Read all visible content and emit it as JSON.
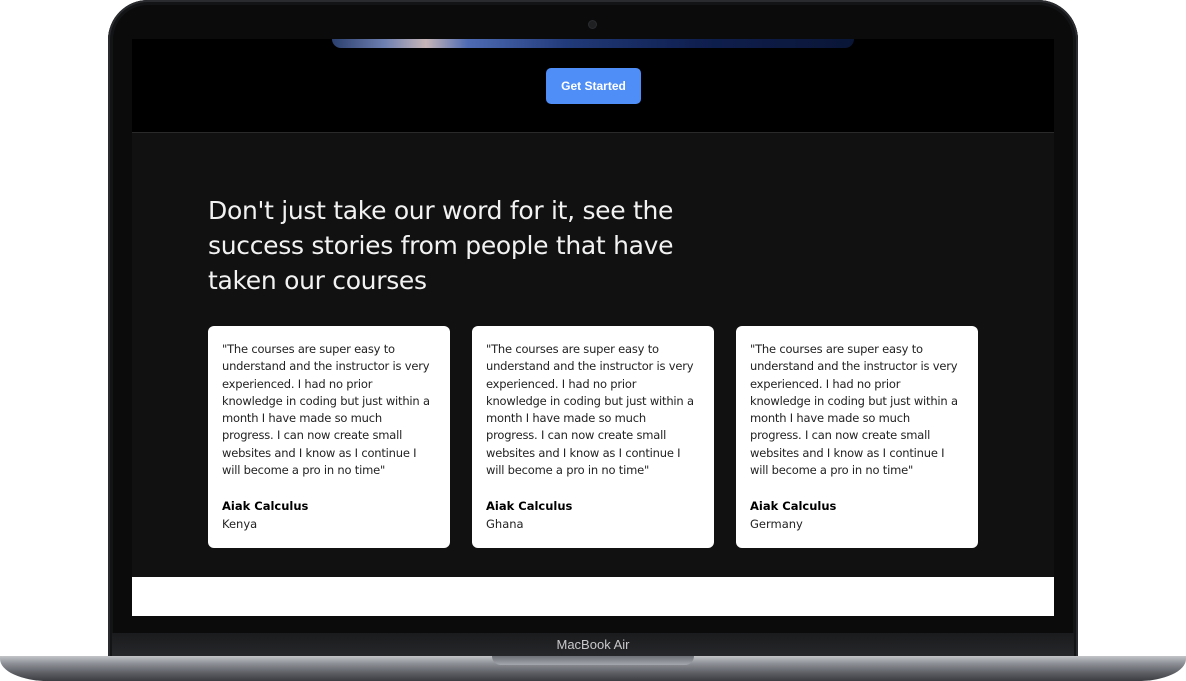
{
  "device": {
    "label": "MacBook Air"
  },
  "hero": {
    "cta_label": "Get Started"
  },
  "testimonials": {
    "heading": "Don't just take our word for it, see the success stories from people that have taken our courses",
    "cards": [
      {
        "quote": "\"The courses are super easy to understand and the instructor is very experienced. I had no prior knowledge in coding but just within a month I have made so much progress. I can now create small websites and I know as I continue I will become a pro in no time\"",
        "name": "Aiak Calculus",
        "country": "Kenya"
      },
      {
        "quote": "\"The courses are super easy to understand and the instructor is very experienced. I had no prior knowledge in coding but just within a month I have made so much progress. I can now create small websites and I know as I continue I will become a pro in no time\"",
        "name": "Aiak Calculus",
        "country": "Ghana"
      },
      {
        "quote": "\"The courses are super easy to understand and the instructor is very experienced. I had no prior knowledge in coding but just within a month I have made so much progress. I can now create small websites and I know as I continue I will become a pro in no time\"",
        "name": "Aiak Calculus",
        "country": "Germany"
      }
    ]
  },
  "colors": {
    "accent": "#4f8ef7",
    "section_bg": "#111111",
    "card_bg": "#ffffff"
  }
}
